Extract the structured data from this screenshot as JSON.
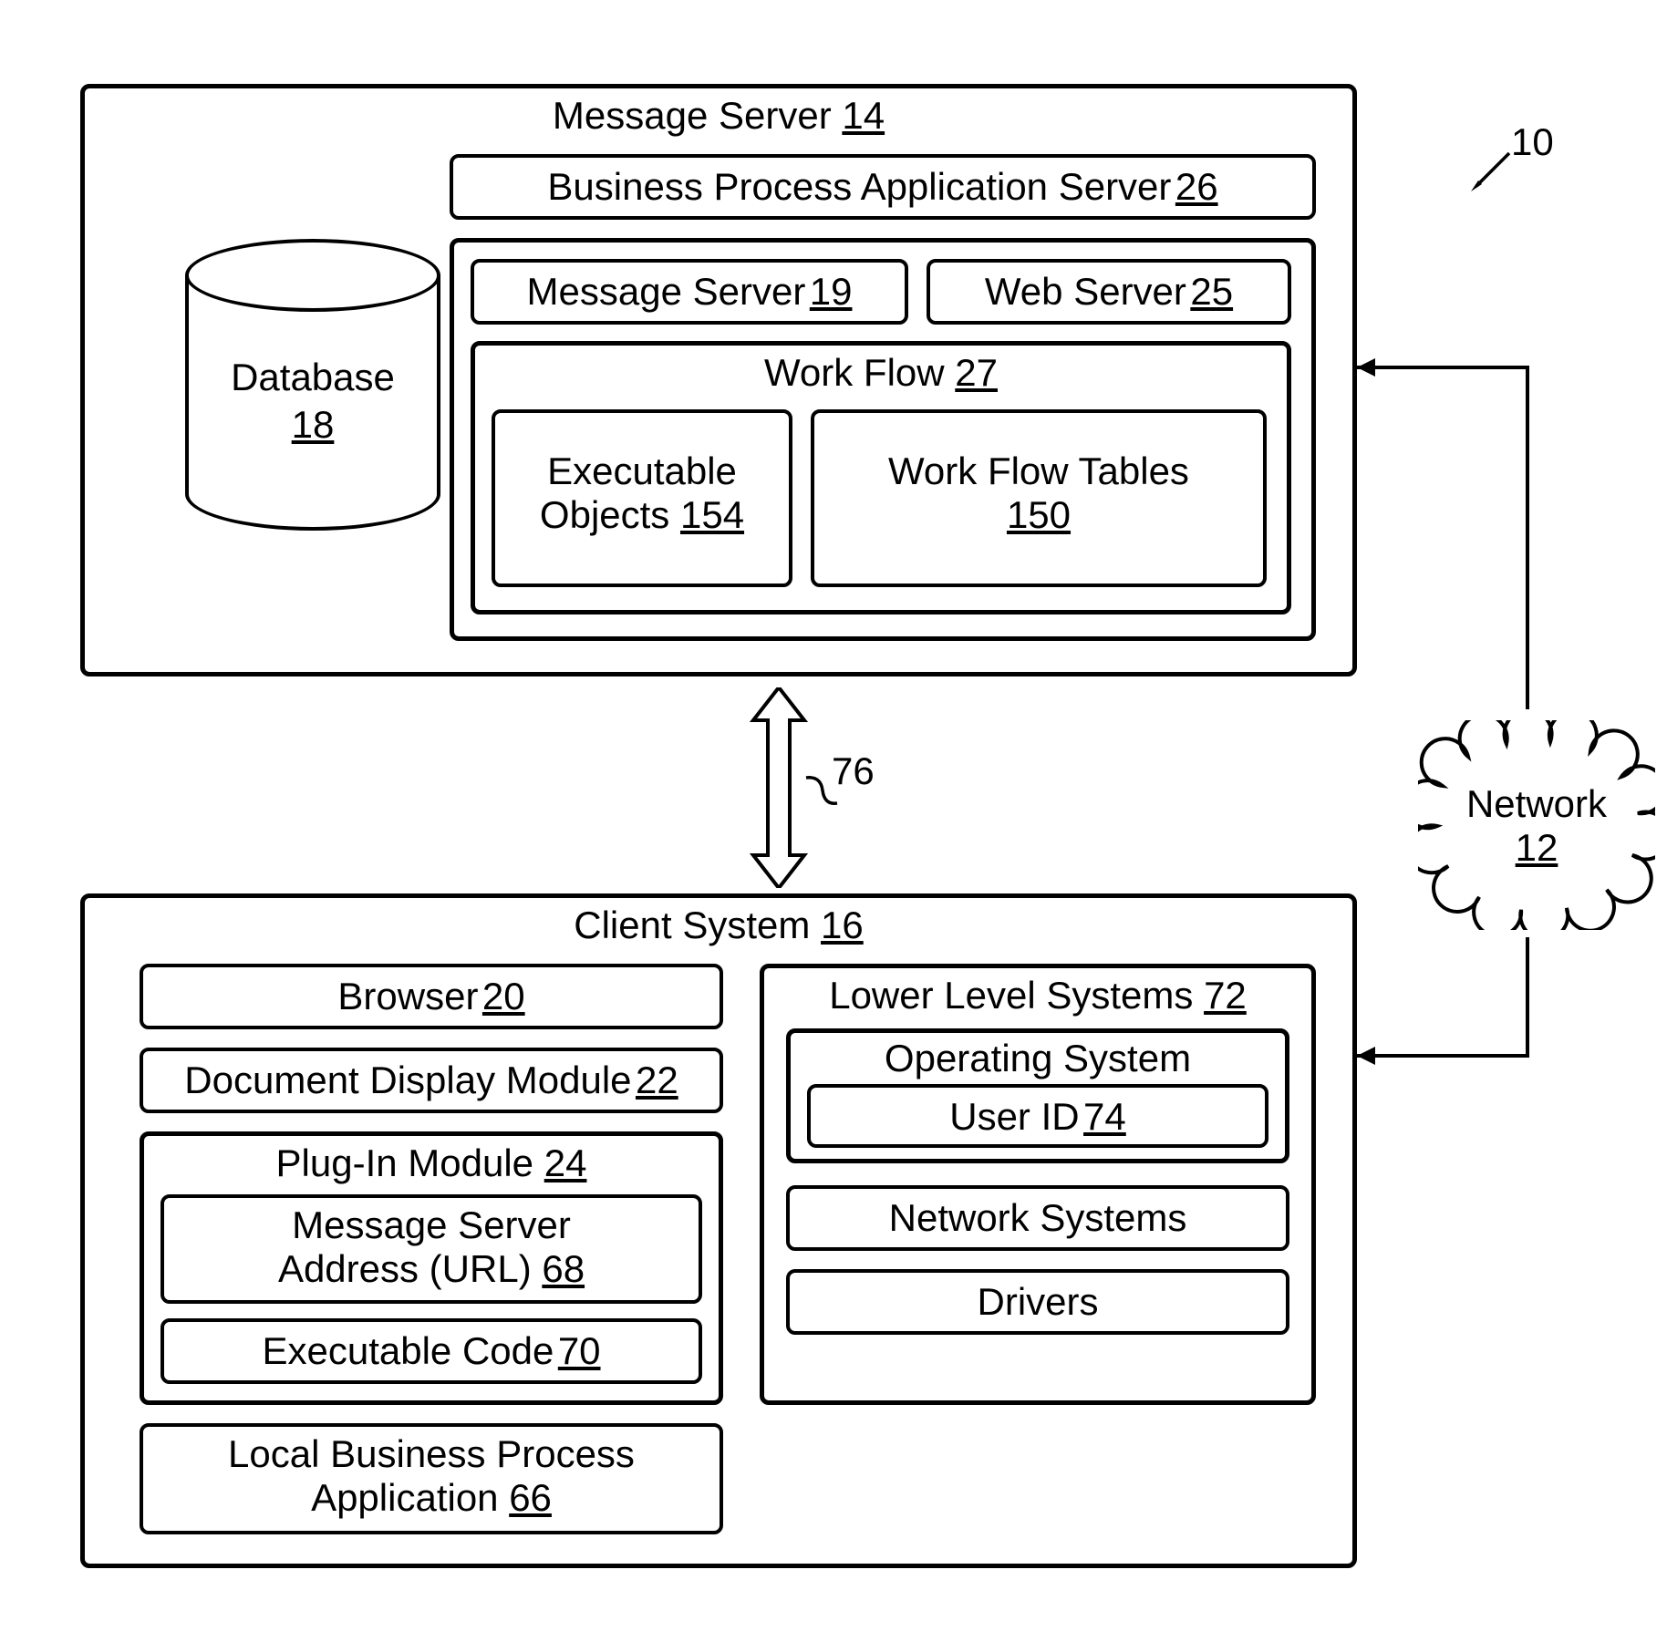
{
  "ref": {
    "figure": "10",
    "connector": "76"
  },
  "message_server": {
    "title": "Message Server",
    "num": "14",
    "bpas": {
      "title": "Business Process Application Server",
      "num": "26"
    },
    "database": {
      "title": "Database",
      "num": "18"
    },
    "inner": {
      "ms": {
        "title": "Message Server",
        "num": "19"
      },
      "web": {
        "title": "Web Server",
        "num": "25"
      },
      "workflow": {
        "title": "Work Flow",
        "num": "27",
        "exec": {
          "title": "Executable Objects",
          "num": "154"
        },
        "tables": {
          "title": "Work Flow Tables",
          "num": "150"
        }
      }
    }
  },
  "network": {
    "title": "Network",
    "num": "12"
  },
  "client": {
    "title": "Client System",
    "num": "16",
    "browser": {
      "title": "Browser",
      "num": "20"
    },
    "ddm": {
      "title": "Document Display Module",
      "num": "22"
    },
    "plugin": {
      "title": "Plug-In Module",
      "num": "24",
      "addr": {
        "title": "Message Server Address (URL)",
        "num": "68"
      },
      "code": {
        "title": "Executable Code",
        "num": "70"
      }
    },
    "lbpa": {
      "title": "Local Business Process Application",
      "num": "66"
    },
    "lls": {
      "title": "Lower Level Systems",
      "num": "72",
      "os": {
        "title": "Operating System",
        "userid": {
          "title": "User ID",
          "num": "74"
        }
      },
      "net": {
        "title": "Network Systems"
      },
      "drv": {
        "title": "Drivers"
      }
    }
  }
}
